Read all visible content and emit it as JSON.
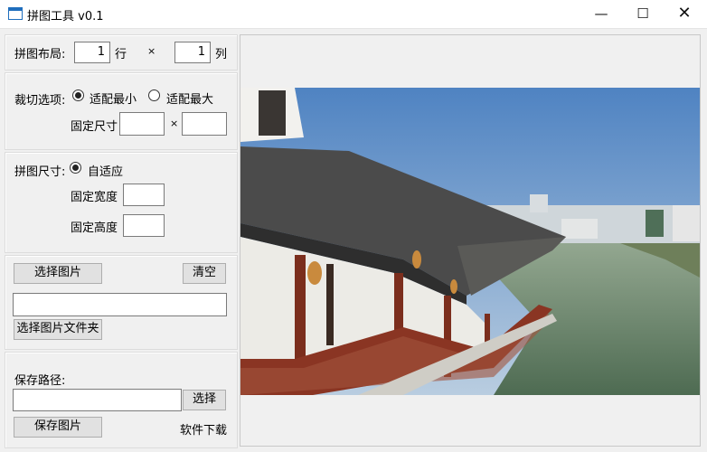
{
  "window": {
    "title": "拼图工具 v0.1",
    "minimize_icon": "—",
    "maximize_icon": "☐",
    "close_icon": "✕"
  },
  "layout_section": {
    "label": "拼图布局:",
    "rows_value": "1",
    "rows_unit": "行",
    "times": "×",
    "cols_value": "1",
    "cols_unit": "列"
  },
  "crop_section": {
    "label": "裁切选项:",
    "option_min": "适配最小",
    "option_max": "适配最大",
    "selected": "适配最小",
    "fixed_size_label": "固定尺寸",
    "times": "×",
    "width_value": "",
    "height_value": ""
  },
  "size_section": {
    "label": "拼图尺寸:",
    "option_auto": "自适应",
    "selected": "自适应",
    "fixed_width_label": "固定宽度",
    "fixed_height_label": "固定高度",
    "width_value": "",
    "height_value": ""
  },
  "images_section": {
    "select_images_label": "选择图片",
    "clear_label": "清空",
    "path_value": "",
    "select_folder_label": "选择图片文件夹"
  },
  "save_section": {
    "label": "保存路径:",
    "path_value": "",
    "browse_label": "选择",
    "save_label": "保存图片",
    "download_label": "软件下载"
  },
  "preview": {
    "description_icon": "photo-preview"
  }
}
